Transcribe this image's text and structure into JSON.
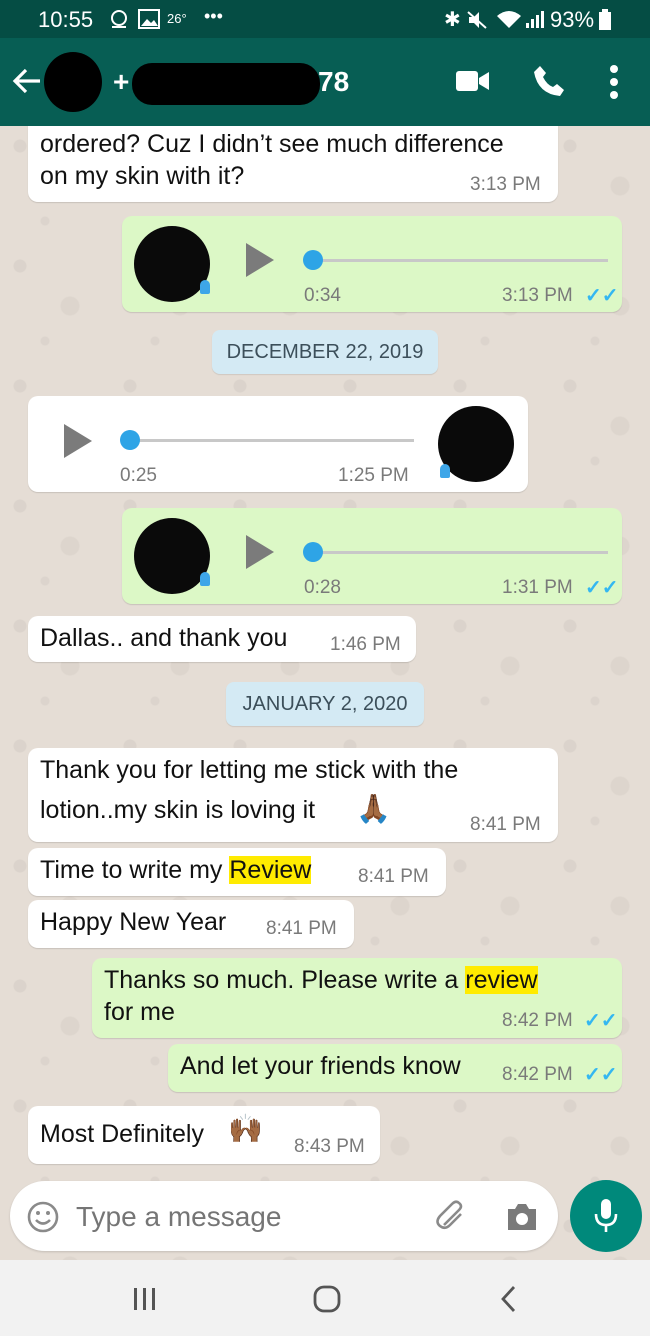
{
  "status_bar": {
    "time": "10:55",
    "temp": "26°",
    "more": "•••",
    "battery": "93%"
  },
  "header": {
    "contact_prefix": "+",
    "contact_suffix": "78"
  },
  "dates": [
    "DECEMBER 22, 2019",
    "JANUARY 2, 2020"
  ],
  "messages": {
    "m1": {
      "line1": "ordered? Cuz I didn’t see much difference",
      "line2": "on my skin with it?",
      "time": "3:13 PM"
    },
    "v1": {
      "duration": "0:34",
      "time": "3:13 PM",
      "ticks": "✓✓"
    },
    "v2": {
      "duration": "0:25",
      "time": "1:25 PM"
    },
    "v3": {
      "duration": "0:28",
      "time": "1:31 PM",
      "ticks": "✓✓"
    },
    "m2": {
      "text": "Dallas.. and thank you",
      "time": "1:46 PM"
    },
    "m3": {
      "line1": "Thank you for letting me stick with the",
      "line2": "lotion..my skin is loving it",
      "emoji": "🙏🏾",
      "time": "8:41 PM"
    },
    "m4": {
      "text_before": "Time to write my ",
      "highlight": "Review",
      "time": "8:41 PM"
    },
    "m5": {
      "text": "Happy New Year",
      "time": "8:41 PM"
    },
    "m6": {
      "text_before": "Thanks so much. Please write a ",
      "highlight": "review",
      "line2": "for me",
      "time": "8:42 PM",
      "ticks": "✓✓"
    },
    "m7": {
      "text": "And let your friends know",
      "time": "8:42 PM",
      "ticks": "✓✓"
    },
    "m8": {
      "text": "Most Definitely",
      "emoji": "🙌🏾",
      "time": "8:43 PM"
    }
  },
  "input": {
    "placeholder": "Type a message"
  },
  "icons": [
    "back-arrow-icon",
    "video-call-icon",
    "voice-call-icon",
    "more-vert-icon",
    "emoji-icon",
    "attach-icon",
    "camera-icon",
    "mic-icon",
    "recents-icon",
    "home-icon",
    "nav-back-icon"
  ],
  "colors": {
    "header": "#075e54",
    "outgoing": "#dcf8c6",
    "incoming": "#ffffff",
    "fab": "#00897b",
    "tick": "#34b7f1"
  }
}
